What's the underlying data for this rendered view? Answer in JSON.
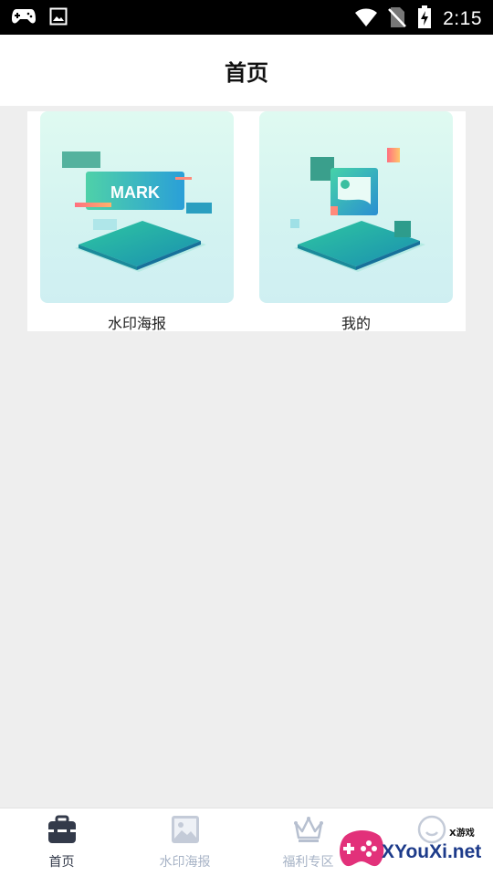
{
  "status_bar": {
    "time": "2:15",
    "icons": [
      "gamepad-icon",
      "image-icon",
      "wifi-icon",
      "no-sim-icon",
      "battery-charging-icon"
    ]
  },
  "header": {
    "title": "首页"
  },
  "cards": [
    {
      "label": "水印海报",
      "art_text": "MARK",
      "icon": "watermark-illustration"
    },
    {
      "label": "我的",
      "icon": "photo-illustration"
    }
  ],
  "bottom_nav": {
    "items": [
      {
        "label": "首页",
        "icon": "toolbox-icon",
        "active": true
      },
      {
        "label": "水印海报",
        "icon": "picture-icon",
        "active": false
      },
      {
        "label": "福利专区",
        "icon": "crown-icon",
        "active": false
      },
      {
        "label": "",
        "icon": "smile-icon",
        "active": false
      }
    ]
  },
  "watermark": {
    "site": "XYouXi.net",
    "small": "X游戏"
  },
  "colors": {
    "active_nav": "#333a4a",
    "inactive_nav": "#a7b3c6",
    "background": "#eeeeee",
    "accent_teal": "#2cc3a4"
  }
}
